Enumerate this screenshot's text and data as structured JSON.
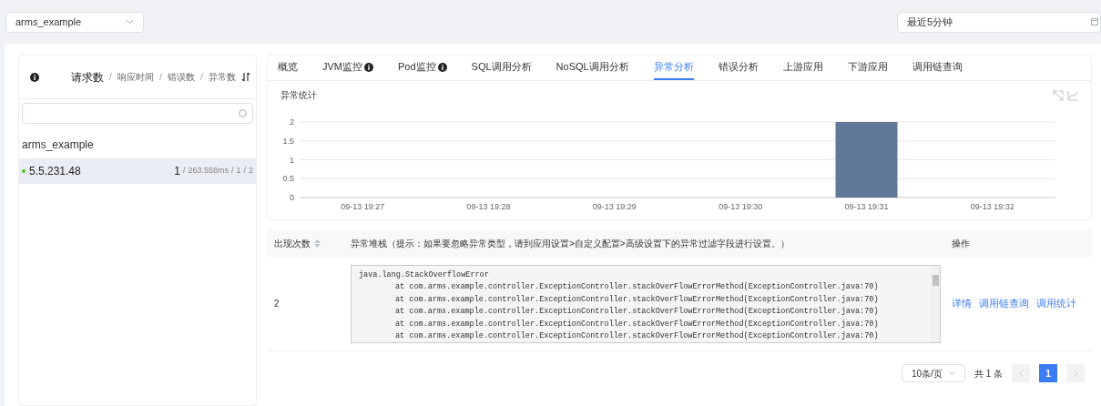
{
  "app_select": {
    "value": "arms_example"
  },
  "time_range": {
    "value": "最近5分钟"
  },
  "sidebar": {
    "metrics": [
      {
        "label": "请求数",
        "selected": true
      },
      {
        "label": "响应时间",
        "selected": false,
        "separator": "/"
      },
      {
        "label": "错误数",
        "selected": false,
        "separator": "/"
      },
      {
        "label": "异常数",
        "selected": false,
        "separator": "/"
      }
    ],
    "group": "arms_example",
    "hosts": [
      {
        "name": "5.5.231.48",
        "color": "#52c41a",
        "selected": true,
        "stats": [
          "1",
          "/",
          "263.558ms",
          "/",
          "1",
          "/",
          "2"
        ]
      }
    ]
  },
  "tabs": [
    {
      "label": "概览",
      "selected": false,
      "info": false
    },
    {
      "label": "JVM监控",
      "selected": false,
      "info": true
    },
    {
      "label": "Pod监控",
      "selected": false,
      "info": true
    },
    {
      "label": "SQL调用分析",
      "selected": false,
      "info": false
    },
    {
      "label": "NoSQL调用分析",
      "selected": false,
      "info": false
    },
    {
      "label": "异常分析",
      "selected": true,
      "info": false
    },
    {
      "label": "错误分析",
      "selected": false,
      "info": false
    },
    {
      "label": "上游应用",
      "selected": false,
      "info": false
    },
    {
      "label": "下游应用",
      "selected": false,
      "info": false
    },
    {
      "label": "调用链查询",
      "selected": false,
      "info": false
    }
  ],
  "chart_panel": {
    "title": "异常统计",
    "chart_data": {
      "type": "bar",
      "categories": [
        "09-13 19:27",
        "09-13 19:28",
        "09-13 19:29",
        "09-13 19:30",
        "09-13 19:31",
        "09-13 19:32"
      ],
      "series": [
        {
          "color": "#62789a",
          "values": [
            0,
            0,
            0,
            0,
            2,
            0
          ]
        }
      ],
      "ylim": [
        0,
        2
      ],
      "yticks": [
        0,
        0.5,
        1,
        1.5,
        2
      ],
      "grid": true
    }
  },
  "table": {
    "columns": [
      {
        "label": "出现次数",
        "sortable": true
      },
      {
        "label": "异常堆栈（提示：如果要忽略异常类型，请到应用设置>自定义配置>高级设置下的异常过滤字段进行设置。）",
        "sortable": false
      },
      {
        "label": "操作",
        "sortable": false
      }
    ],
    "rows": [
      {
        "count": "2",
        "stack": [
          {
            "kind": "exception",
            "text": "java.lang.StackOverflowError"
          },
          {
            "kind": "frame",
            "text": "at com.arms.example.controller.ExceptionController.stackOverFlowErrorMethod(ExceptionController.java:70)"
          },
          {
            "kind": "frame",
            "text": "at com.arms.example.controller.ExceptionController.stackOverFlowErrorMethod(ExceptionController.java:70)"
          },
          {
            "kind": "frame",
            "text": "at com.arms.example.controller.ExceptionController.stackOverFlowErrorMethod(ExceptionController.java:70)"
          },
          {
            "kind": "frame",
            "text": "at com.arms.example.controller.ExceptionController.stackOverFlowErrorMethod(ExceptionController.java:70)"
          },
          {
            "kind": "frame",
            "text": "at com.arms.example.controller.ExceptionController.stackOverFlowErrorMethod(ExceptionController.java:70)"
          }
        ],
        "actions": [
          "详情",
          "调用链查询",
          "调用统计"
        ]
      }
    ]
  },
  "pagination": {
    "page_size": "10条/页",
    "total": "共 1 条",
    "pages": [
      {
        "label": "1",
        "selected": true
      }
    ],
    "prev_disabled": true,
    "next_disabled": true
  }
}
